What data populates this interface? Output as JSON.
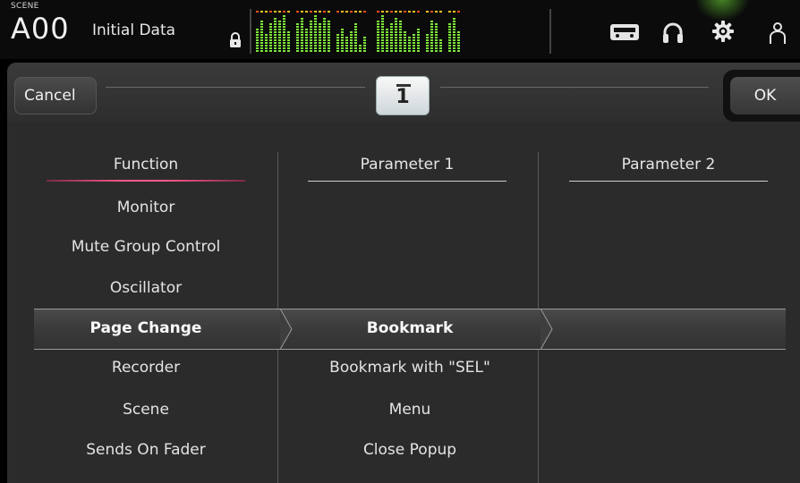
{
  "status_bar": {
    "scene_label": "SCENE",
    "scene_number": "A00",
    "scene_name": "Initial Data",
    "icons": [
      "lock-icon",
      "level-meters",
      "recorder-icon",
      "headphones-icon",
      "settings-gear-icon",
      "user-icon"
    ],
    "accent_glow": "#78f03c"
  },
  "dialog": {
    "cancel_label": "Cancel",
    "ok_label": "OK",
    "key_number": "1",
    "columns": {
      "function": {
        "header": "Function",
        "items": [
          "Monitor",
          "Mute Group Control",
          "Oscillator",
          "Page Change",
          "Recorder",
          "Scene",
          "Sends On Fader"
        ],
        "selected": "Page Change"
      },
      "parameter1": {
        "header": "Parameter 1",
        "items": [
          "Bookmark",
          "Bookmark with \"SEL\"",
          "Menu",
          "Close Popup"
        ],
        "selected": "Bookmark"
      },
      "parameter2": {
        "header": "Parameter 2",
        "items": []
      }
    },
    "colors": {
      "function_underline": "#ff5a8a",
      "panel_bg": "#2b2b2b"
    }
  }
}
